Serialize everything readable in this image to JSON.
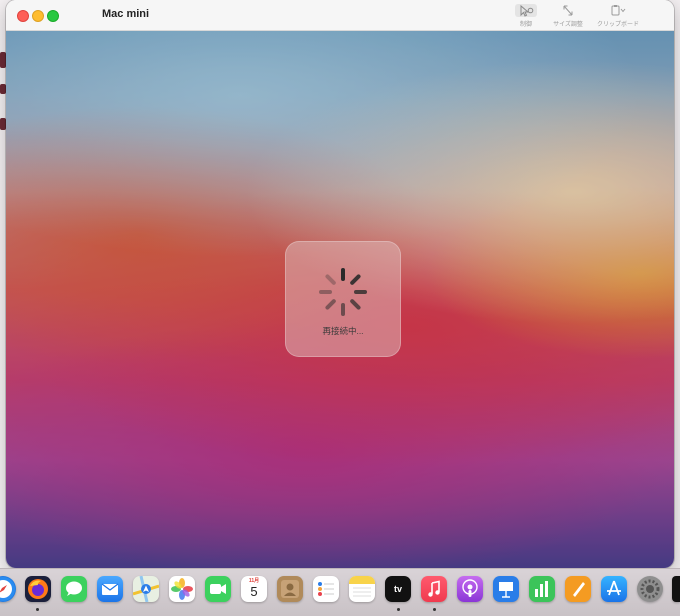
{
  "window": {
    "title": "Mac mini"
  },
  "toolbar": {
    "items": [
      {
        "icon": "pointer-icon",
        "label": "制御"
      },
      {
        "icon": "resize-arrows-icon",
        "label": "サイズ調整"
      },
      {
        "icon": "clipboard-icon",
        "label": "クリップボード"
      }
    ]
  },
  "hud": {
    "label": "再接続中..."
  },
  "dock": {
    "calendar": {
      "month": "11月",
      "day": "5"
    },
    "tv": {
      "label": "tv"
    },
    "apps": [
      "Safari",
      "Firefox",
      "Messages",
      "Mail",
      "Maps",
      "Photos",
      "FaceTime",
      "Calendar",
      "Contacts",
      "Reminders",
      "Notes",
      "TV",
      "Music",
      "Podcasts",
      "Keynote",
      "Numbers",
      "Pages",
      "App Store",
      "System Preferences"
    ]
  },
  "colors": {
    "close": "#fe5f57",
    "minimize": "#febc2e",
    "zoom": "#28c840"
  }
}
